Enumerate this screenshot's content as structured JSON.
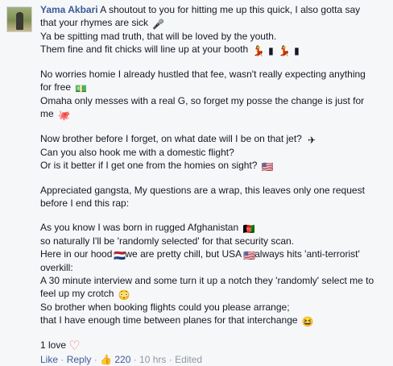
{
  "comment": {
    "author": "Yama Akbari",
    "text_first_line": "A shoutout to you for hitting me up this quick, I also gotta say",
    "line2": "that your rhymes are sick",
    "line3": "Ya be spitting mad truth, that will be loved by the youth.",
    "line4": "Them fine and fit chicks will line up at your booth",
    "p2_l1": "No worries homie I already hustled that fee, wasn't really expecting anything",
    "p2_l2": "for free",
    "p2_l3": "Omaha only messes with a real G, so forget my posse the change is just for",
    "p2_l4": "me",
    "p3_l1": "Now brother before I forget, on what date will I be on that jet?",
    "p3_l2": "Can you also hook me with a domestic flight?",
    "p3_l3": "Or is it better if I get one from the homies on sight?",
    "p4_l1": "Appreciated gangsta, My questions are a wrap, this leaves only one request",
    "p4_l2": "before I end this rap:",
    "p5_l1": "As you know I was born in rugged Afghanistan",
    "p5_l2": "so naturally I'll be 'randomly selected' for that security scan.",
    "p5_l3a": "Here in our hood",
    "p5_l3b": "we are pretty chill, but USA",
    "p5_l3c": "always hits 'anti-terrorist'",
    "p5_l4": "overkill:",
    "p5_l5": "A 30 minute interview and some turn it up a notch they 'randomly' select me to",
    "p5_l6": "feel up my crotch",
    "p5_l7": "So brother when booking flights could you please arrange;",
    "p5_l8": "that I have enough time between planes for that interchange"
  },
  "reactions": {
    "label": "1 love"
  },
  "footer": {
    "like": "Like",
    "sep1": " · ",
    "reply": "Reply",
    "sep2": " · ",
    "like_count": "220",
    "sep3": " · ",
    "time": "10 hrs",
    "sep4": " · ",
    "edited": "Edited"
  },
  "icons": {
    "microphone": "microphone-icon",
    "dancer": "dancer-icon",
    "money": "money-icon",
    "octopus": "octopus-icon",
    "airplane": "airplane-icon",
    "us_flag": "us-flag-icon",
    "af_flag": "afghanistan-flag-icon",
    "nl_flag": "netherlands-flag-icon",
    "smiley": "smiley-icon",
    "heart": "heart-icon",
    "thumbs_up": "thumbs-up-icon"
  },
  "colors": {
    "name_link": "#3b5998",
    "meta_gray": "#9197a3",
    "heart": "#f08080"
  }
}
